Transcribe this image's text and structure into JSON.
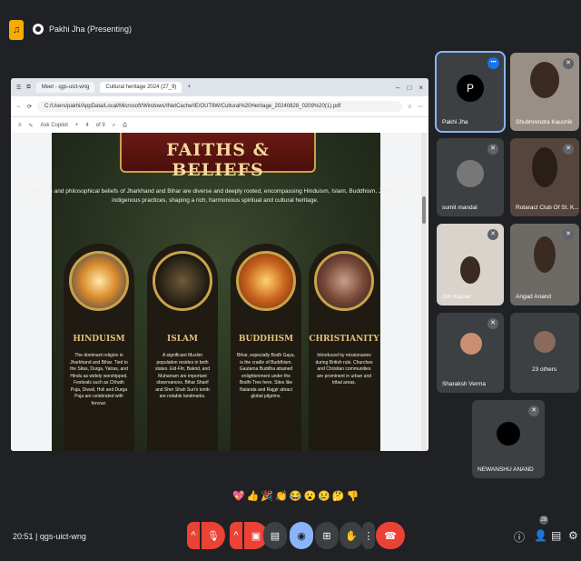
{
  "presenting": {
    "label": "Pakhi Jha (Presenting)"
  },
  "browser": {
    "tabs": [
      {
        "label": "Meet - qgs-uict-wng"
      },
      {
        "label": "Cultural heritage 2024 (27_9)"
      }
    ],
    "url": "C:/Users/pakhi/AppData/Local/Microsoft/Windows/INetCache/IE/OUT8W/Cultural%20Heritage_20240828_0209%20(1).pdf",
    "pdf_toolbar": {
      "ask": "Ask Copilot",
      "zoom": "+",
      "page": "4",
      "of": "of 9"
    }
  },
  "slide": {
    "title": "FAITHS & BELIEFS",
    "intro": "The religious and philosophical beliefs of Jharkhand and Bihar are diverse and deeply rooted, encompassing Hinduism, Islam, Buddhism, Jainism, and indigenous practices, shaping a rich, harmonious spiritual and cultural heritage.",
    "cards": [
      {
        "title": "HINDUISM",
        "text": "The dominant religion in Jharkhand and Bihar. Tied to the Sitas, Durga, Yatras, and Hindu as widely worshipped. Festivals such as Chhath Puja, Diwali, Holi and Durga Puja are celebrated with fervour."
      },
      {
        "title": "ISLAM",
        "text": "A significant Muslim population resides in both states. Eid-Fitr, Bakrid, and Muharram are important observances. Bihar Sharif and Sher Shah Suri's tomb are notable landmarks."
      },
      {
        "title": "BUDDHISM",
        "text": "Bihar, especially Bodh Gaya, is the cradle of Buddhism. Gautama Buddha attained enlightenment under the Bodhi Tree here. Sites like Nalanda and Rajgir attract global pilgrims."
      },
      {
        "title": "CHRISTIANITY",
        "text": "Introduced by missionaries during British rule. Churches and Christian communities are prominent in urban and tribal areas."
      }
    ]
  },
  "participants": [
    {
      "name": "Pakhi Jha",
      "initial": "P"
    },
    {
      "name": "Shubhrendra Kaushik"
    },
    {
      "name": "sumit mandal"
    },
    {
      "name": "Rotaract Club Of St. K..."
    },
    {
      "name": "Om Kumar"
    },
    {
      "name": "Angad Anand"
    },
    {
      "name": "Sharaksh Verma"
    },
    {
      "name": "23 others"
    },
    {
      "name": "NEWANSHU ANAND"
    }
  ],
  "reactions": [
    "💖",
    "👍",
    "🎉",
    "👏",
    "😂",
    "😮",
    "😢",
    "🤔",
    "👎"
  ],
  "footer": {
    "time": "20:51",
    "separator": "|",
    "meeting_code": "qgs-uict-wng",
    "people_badge": "28"
  },
  "colors": {
    "bg": "#202124",
    "tile": "#3c4043",
    "end_call": "#ea4335",
    "accent": "#8ab4f8"
  }
}
